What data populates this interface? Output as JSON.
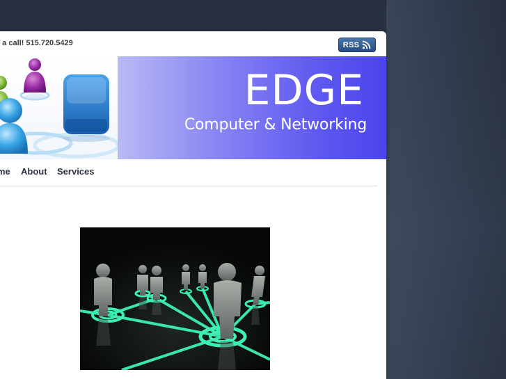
{
  "topbar": {
    "call_text": "s a call! 515.720.5429",
    "rss_label": "RSS"
  },
  "banner": {
    "title": "EDGE",
    "subtitle": "Computer & Networking"
  },
  "nav": {
    "items": [
      {
        "label": "me"
      },
      {
        "label": "About"
      },
      {
        "label": "Services"
      }
    ]
  },
  "colors": {
    "page_background": "#2a3140",
    "banner_start": "#b9b9f4",
    "banner_end": "#4b44ec",
    "nav_text": "#2d3444",
    "rss_button": "#274e80",
    "network_glow": "#3df0b6"
  },
  "icons": {
    "rss": "rss-feed-icon",
    "header_art": "network-people-illustration",
    "photo": "network-people-photo"
  }
}
